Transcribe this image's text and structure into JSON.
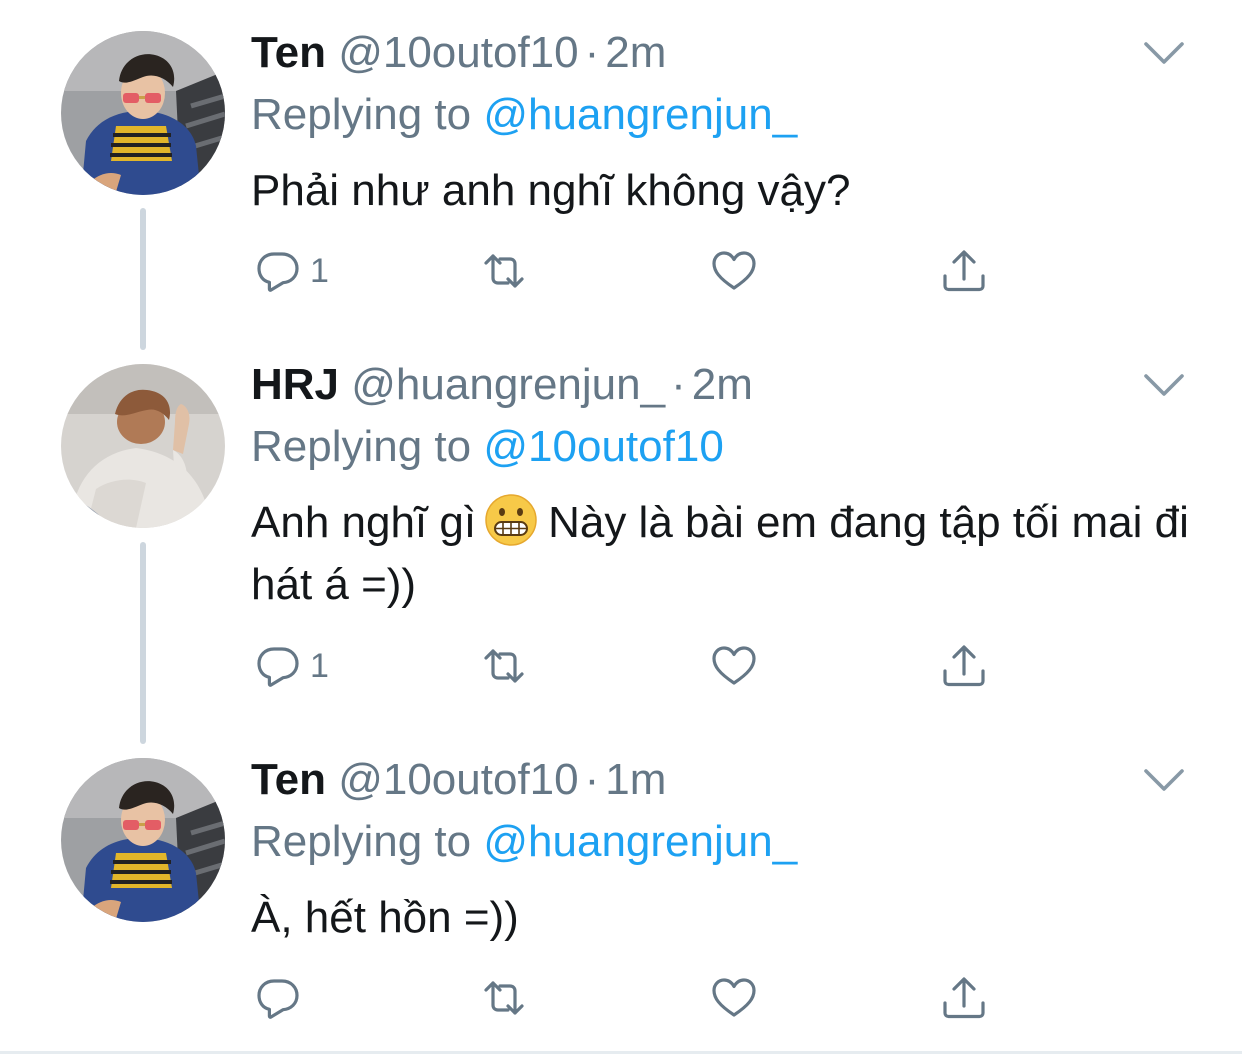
{
  "colors": {
    "text": "#14171a",
    "muted": "#657786",
    "link": "#1da1f2",
    "thread_line": "#cdd6de"
  },
  "icons": {
    "reply": "reply-icon",
    "retweet": "retweet-icon",
    "like": "heart-icon",
    "share": "share-icon",
    "menu": "chevron-down-icon"
  },
  "tweets": [
    {
      "name": "Ten",
      "handle": "@10outof10",
      "separator": "·",
      "time": "2m",
      "reply_prefix": "Replying to",
      "reply_to": "@huangrenjun_",
      "text": "Phải như anh nghĩ không vậy?",
      "reply_count": "1"
    },
    {
      "name": "HRJ",
      "handle": "@huangrenjun_",
      "separator": "·",
      "time": "2m",
      "reply_prefix": "Replying to",
      "reply_to": "@10outof10",
      "text_before": "Anh nghĩ gì",
      "emoji": "grimacing-face",
      "text_after": "Này là bài em đang tập tối mai đi hát á =))",
      "reply_count": "1"
    },
    {
      "name": "Ten",
      "handle": "@10outof10",
      "separator": "·",
      "time": "1m",
      "reply_prefix": "Replying to",
      "reply_to": "@huangrenjun_",
      "text": "À, hết hồn =))",
      "reply_count": ""
    }
  ]
}
